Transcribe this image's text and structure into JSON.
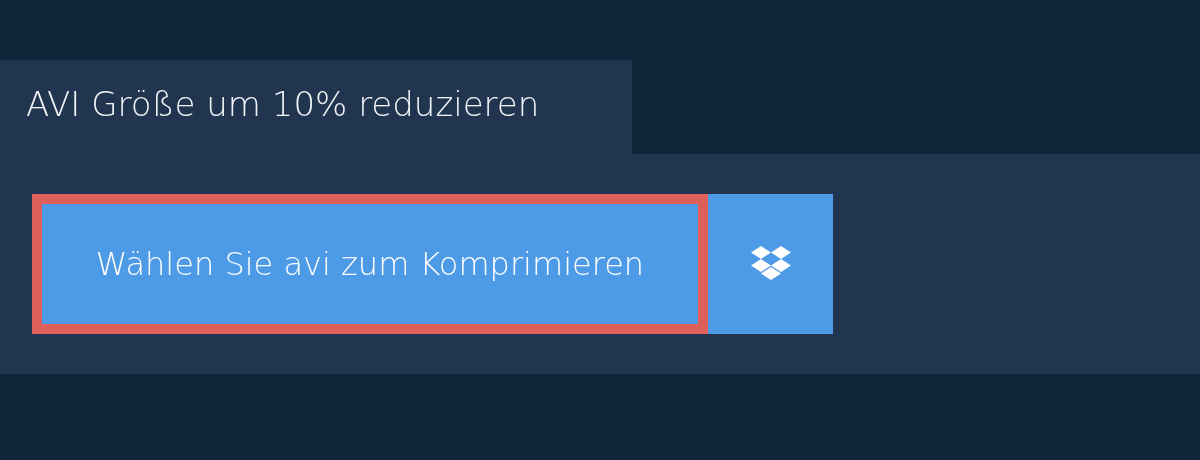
{
  "tab": {
    "label": "AVI Größe um 10% reduzieren"
  },
  "upload_button": {
    "label": "Wählen Sie avi zum Komprimieren",
    "highlighted": true
  }
}
